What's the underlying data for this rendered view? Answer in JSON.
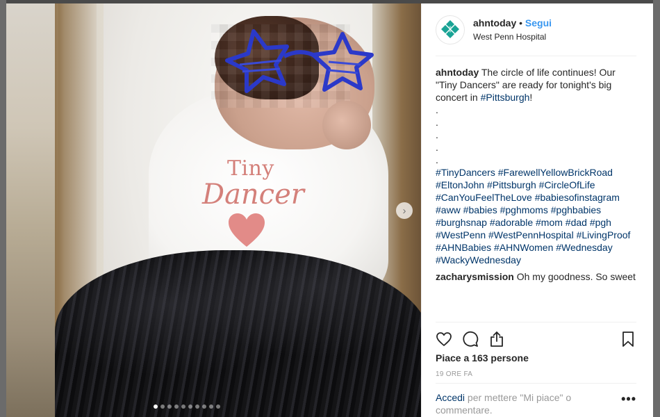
{
  "photo": {
    "onesie_line1": "Tiny",
    "onesie_line2": "Dancer",
    "carousel": {
      "count": 10,
      "active_index": 0
    }
  },
  "header": {
    "username": "ahntoday",
    "separator": "•",
    "follow_label": "Segui",
    "location": "West Penn Hospital"
  },
  "caption": {
    "username": "ahntoday",
    "text_before_link": "The circle of life continues! Our \"Tiny Dancers\" are ready for tonight's big concert in ",
    "link": "#Pittsburgh",
    "text_after_link": "!",
    "dot_lines": [
      ".",
      ".",
      ".",
      ".",
      "."
    ],
    "hashtags": "#TinyDancers #FarewellYellowBrickRoad #EltonJohn #Pittsburgh #CircleOfLife #CanYouFeelTheLove #babiesofinstagram #aww #babies #pghmoms #pghbabies #burghsnap #adorable #mom #dad #pgh #WestPenn #WestPennHospital #LivingProof #AHNBabies #AHNWomen #Wednesday #WackyWednesday"
  },
  "comment": {
    "username": "zacharysmission",
    "text": "Oh my goodness. So sweet"
  },
  "likes_text": "Piace a 163 persone",
  "timestamp": "19 ORE FA",
  "login": {
    "link": "Accedi",
    "text": " per mettere \"Mi piace\" o commentare.",
    "more": "•••"
  },
  "colors": {
    "accent": "#3897f0",
    "link": "#003569",
    "text": "#262626",
    "muted": "#999999",
    "logo": "#1aa395"
  },
  "icons": [
    "logo-icon",
    "heart-icon",
    "comment-icon",
    "share-icon",
    "bookmark-icon",
    "chevron-right-icon"
  ]
}
